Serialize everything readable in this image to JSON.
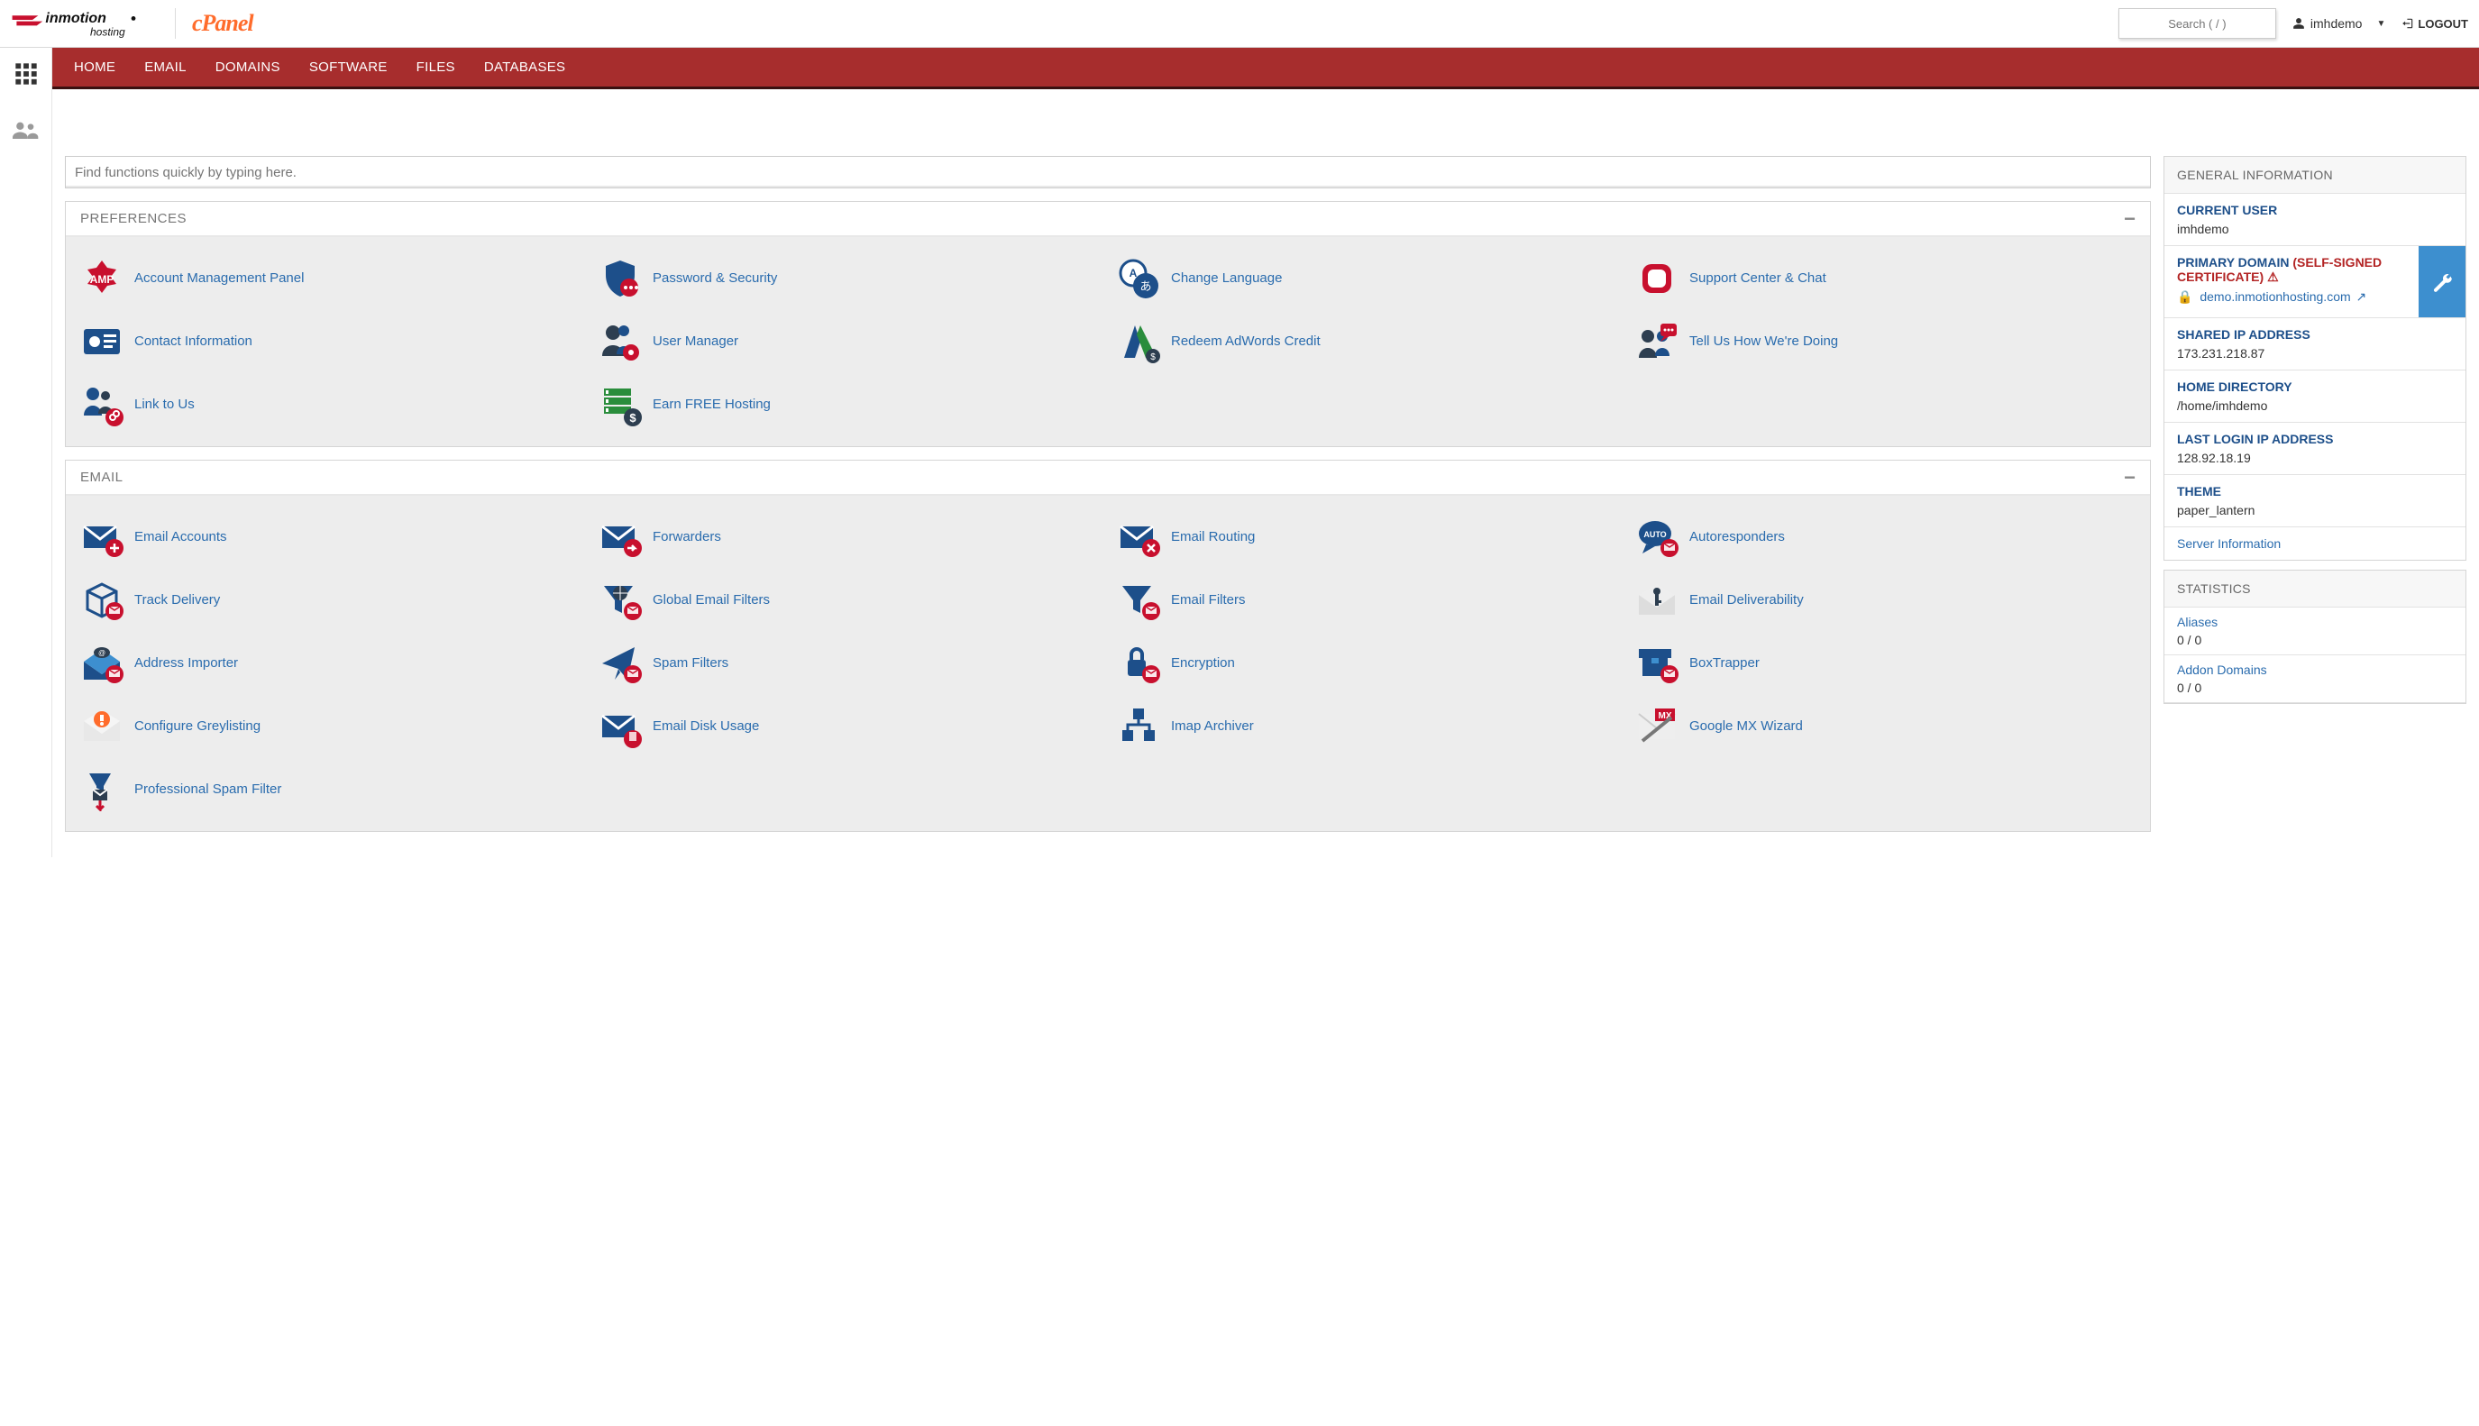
{
  "header": {
    "search_placeholder": "Search ( / )",
    "username": "imhdemo",
    "logout_label": "LOGOUT"
  },
  "nav": {
    "items": [
      "HOME",
      "EMAIL",
      "DOMAINS",
      "SOFTWARE",
      "FILES",
      "DATABASES"
    ]
  },
  "find": {
    "placeholder": "Find functions quickly by typing here."
  },
  "panels": [
    {
      "title": "PREFERENCES",
      "items": [
        {
          "icon": "amp",
          "label": "Account Management Panel"
        },
        {
          "icon": "shield-lock",
          "label": "Password & Security"
        },
        {
          "icon": "globe-lang",
          "label": "Change Language"
        },
        {
          "icon": "support",
          "label": "Support Center & Chat"
        },
        {
          "icon": "contact-card",
          "label": "Contact Information"
        },
        {
          "icon": "user-gear",
          "label": "User Manager"
        },
        {
          "icon": "adwords",
          "label": "Redeem AdWords Credit"
        },
        {
          "icon": "feedback",
          "label": "Tell Us How We're Doing"
        },
        {
          "icon": "link-people",
          "label": "Link to Us"
        },
        {
          "icon": "servers-money",
          "label": "Earn FREE Hosting"
        }
      ]
    },
    {
      "title": "EMAIL",
      "items": [
        {
          "icon": "mail-plus",
          "label": "Email Accounts"
        },
        {
          "icon": "mail-forward",
          "label": "Forwarders"
        },
        {
          "icon": "mail-route",
          "label": "Email Routing"
        },
        {
          "icon": "auto-reply",
          "label": "Autoresponders"
        },
        {
          "icon": "track-box",
          "label": "Track Delivery"
        },
        {
          "icon": "filter-globe",
          "label": "Global Email Filters"
        },
        {
          "icon": "filter-mail",
          "label": "Email Filters"
        },
        {
          "icon": "mail-key",
          "label": "Email Deliverability"
        },
        {
          "icon": "address-import",
          "label": "Address Importer"
        },
        {
          "icon": "paper-plane",
          "label": "Spam Filters"
        },
        {
          "icon": "lock-mail",
          "label": "Encryption"
        },
        {
          "icon": "boxtrapper",
          "label": "BoxTrapper"
        },
        {
          "icon": "greylist",
          "label": "Configure Greylisting"
        },
        {
          "icon": "disk-usage",
          "label": "Email Disk Usage"
        },
        {
          "icon": "imap-archive",
          "label": "Imap Archiver"
        },
        {
          "icon": "google-mx",
          "label": "Google MX Wizard"
        },
        {
          "icon": "pro-spam",
          "label": "Professional Spam Filter"
        }
      ]
    }
  ],
  "general_info": {
    "title": "GENERAL INFORMATION",
    "rows": {
      "current_user": {
        "label": "CURRENT USER",
        "value": "imhdemo"
      },
      "primary_domain": {
        "label": "PRIMARY DOMAIN",
        "warning": "(SELF-SIGNED CERTIFICATE)",
        "domain": "demo.inmotionhosting.com"
      },
      "shared_ip": {
        "label": "SHARED IP ADDRESS",
        "value": "173.231.218.87"
      },
      "home_dir": {
        "label": "HOME DIRECTORY",
        "value": "/home/imhdemo"
      },
      "last_login": {
        "label": "LAST LOGIN IP ADDRESS",
        "value": "128.92.18.19"
      },
      "theme": {
        "label": "THEME",
        "value": "paper_lantern"
      },
      "server_info": {
        "label": "Server Information"
      }
    }
  },
  "statistics": {
    "title": "STATISTICS",
    "rows": [
      {
        "label": "Aliases",
        "value": "0 / 0"
      },
      {
        "label": "Addon Domains",
        "value": "0 / 0"
      }
    ]
  }
}
